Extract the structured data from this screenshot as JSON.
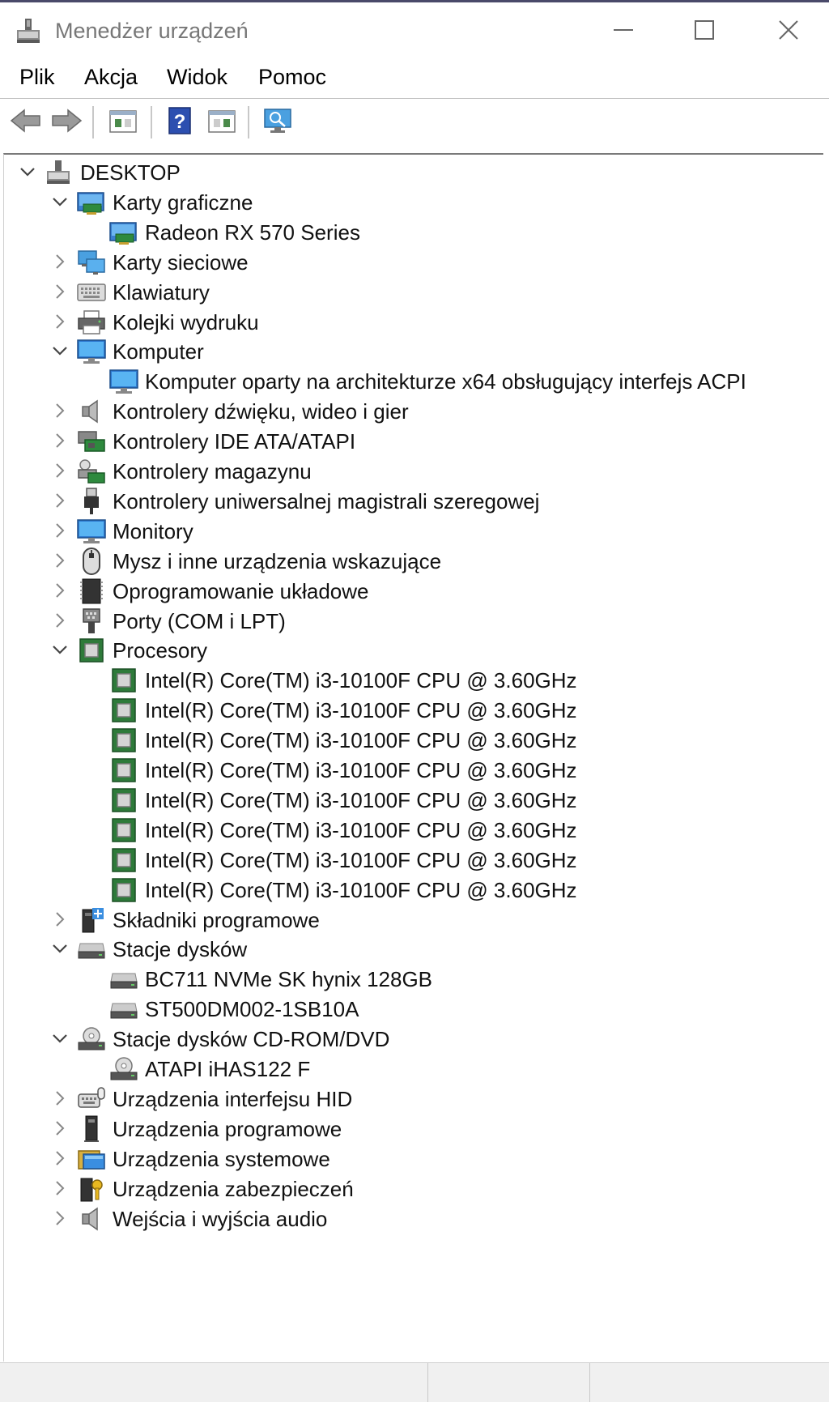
{
  "window": {
    "title": "Menedżer urządzeń",
    "controls": {
      "minimize": "minimize-icon",
      "maximize": "maximize-icon",
      "close": "close-icon"
    }
  },
  "menu": {
    "items": [
      "Plik",
      "Akcja",
      "Widok",
      "Pomoc"
    ]
  },
  "toolbar": {
    "buttons": [
      "back-arrow-icon",
      "forward-arrow-icon",
      "properties-icon",
      "help-icon",
      "view-icon",
      "scan-hardware-icon"
    ]
  },
  "tree": {
    "root": "DESKTOP",
    "nodes": [
      {
        "label": "Karty graficzne",
        "icon": "display-adapter-icon",
        "expanded": true,
        "children": [
          {
            "label": "Radeon RX 570 Series",
            "icon": "display-adapter-icon"
          }
        ]
      },
      {
        "label": "Karty sieciowe",
        "icon": "network-adapter-icon",
        "expanded": false
      },
      {
        "label": "Klawiatury",
        "icon": "keyboard-icon",
        "expanded": false
      },
      {
        "label": "Kolejki wydruku",
        "icon": "printer-icon",
        "expanded": false
      },
      {
        "label": "Komputer",
        "icon": "computer-icon",
        "expanded": true,
        "children": [
          {
            "label": "Komputer oparty na architekturze x64 obsługujący interfejs ACPI",
            "icon": "computer-icon"
          }
        ]
      },
      {
        "label": "Kontrolery dźwięku, wideo i gier",
        "icon": "speaker-icon",
        "expanded": false
      },
      {
        "label": "Kontrolery IDE ATA/ATAPI",
        "icon": "ide-controller-icon",
        "expanded": false
      },
      {
        "label": "Kontrolery magazynu",
        "icon": "storage-controller-icon",
        "expanded": false
      },
      {
        "label": "Kontrolery uniwersalnej magistrali szeregowej",
        "icon": "usb-icon",
        "expanded": false
      },
      {
        "label": "Monitory",
        "icon": "monitor-icon",
        "expanded": false
      },
      {
        "label": "Mysz i inne urządzenia wskazujące",
        "icon": "mouse-icon",
        "expanded": false
      },
      {
        "label": "Oprogramowanie układowe",
        "icon": "firmware-icon",
        "expanded": false
      },
      {
        "label": "Porty (COM i LPT)",
        "icon": "port-icon",
        "expanded": false
      },
      {
        "label": "Procesory",
        "icon": "processor-icon",
        "expanded": true,
        "children": [
          {
            "label": "Intel(R) Core(TM) i3-10100F CPU @ 3.60GHz",
            "icon": "processor-icon"
          },
          {
            "label": "Intel(R) Core(TM) i3-10100F CPU @ 3.60GHz",
            "icon": "processor-icon"
          },
          {
            "label": "Intel(R) Core(TM) i3-10100F CPU @ 3.60GHz",
            "icon": "processor-icon"
          },
          {
            "label": "Intel(R) Core(TM) i3-10100F CPU @ 3.60GHz",
            "icon": "processor-icon"
          },
          {
            "label": "Intel(R) Core(TM) i3-10100F CPU @ 3.60GHz",
            "icon": "processor-icon"
          },
          {
            "label": "Intel(R) Core(TM) i3-10100F CPU @ 3.60GHz",
            "icon": "processor-icon"
          },
          {
            "label": "Intel(R) Core(TM) i3-10100F CPU @ 3.60GHz",
            "icon": "processor-icon"
          },
          {
            "label": "Intel(R) Core(TM) i3-10100F CPU @ 3.60GHz",
            "icon": "processor-icon"
          }
        ]
      },
      {
        "label": "Składniki programowe",
        "icon": "software-component-icon",
        "expanded": false
      },
      {
        "label": "Stacje dysków",
        "icon": "disk-drive-icon",
        "expanded": true,
        "children": [
          {
            "label": "BC711 NVMe SK hynix 128GB",
            "icon": "disk-drive-icon"
          },
          {
            "label": "ST500DM002-1SB10A",
            "icon": "disk-drive-icon"
          }
        ]
      },
      {
        "label": "Stacje dysków CD-ROM/DVD",
        "icon": "cdrom-icon",
        "expanded": true,
        "children": [
          {
            "label": "ATAPI iHAS122   F",
            "icon": "cdrom-icon"
          }
        ]
      },
      {
        "label": "Urządzenia interfejsu HID",
        "icon": "hid-icon",
        "expanded": false
      },
      {
        "label": "Urządzenia programowe",
        "icon": "software-device-icon",
        "expanded": false
      },
      {
        "label": "Urządzenia systemowe",
        "icon": "system-device-icon",
        "expanded": false
      },
      {
        "label": "Urządzenia zabezpieczeń",
        "icon": "security-device-icon",
        "expanded": false
      },
      {
        "label": "Wejścia i wyjścia audio",
        "icon": "audio-io-icon",
        "expanded": false
      }
    ]
  }
}
